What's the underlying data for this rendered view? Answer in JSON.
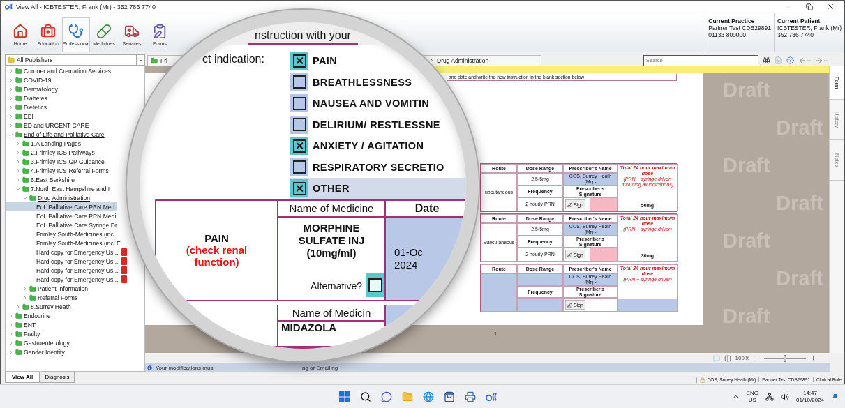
{
  "window": {
    "title": "View All  -  ICBTESTER, Frank (Mr)  -  352 786 7740"
  },
  "toolbar": {
    "buttons": [
      {
        "label": "Home",
        "kind": "home",
        "selected": false
      },
      {
        "label": "Education",
        "kind": "education",
        "selected": false
      },
      {
        "label": "Professional",
        "kind": "professional",
        "selected": true
      },
      {
        "label": "Medicines",
        "kind": "medicines",
        "selected": false
      },
      {
        "label": "Services",
        "kind": "services",
        "selected": false
      },
      {
        "label": "Forms",
        "kind": "forms",
        "selected": false
      }
    ],
    "practice": {
      "heading": "Current Practice",
      "name": "Partner Test CDB29891",
      "phone": "01133 800000"
    },
    "patient": {
      "heading": "Current Patient",
      "name": "ICBTESTER, Frank (Mr)",
      "phone": "352 786 7740"
    }
  },
  "sidebar": {
    "publisher": "All Publishers",
    "tree": [
      {
        "label": "Coroner and Cremation Services",
        "kind": "folder",
        "expanded": false,
        "selected": false
      },
      {
        "label": "COVID-19",
        "kind": "folder",
        "expanded": false,
        "selected": false
      },
      {
        "label": "Dermatology",
        "kind": "folder",
        "expanded": false,
        "selected": false
      },
      {
        "label": "Diabetes",
        "kind": "folder",
        "expanded": false,
        "selected": false
      },
      {
        "label": "Dietetics",
        "kind": "folder",
        "expanded": false,
        "selected": false
      },
      {
        "label": "EBI",
        "kind": "folder",
        "expanded": false,
        "selected": false
      },
      {
        "label": "ED and URGENT CARE",
        "kind": "folder",
        "expanded": false,
        "selected": false
      },
      {
        "label": "End of Life and Palliative Care",
        "kind": "folder",
        "expanded": true,
        "selected": false,
        "children": [
          {
            "label": "1.A Landing Pages",
            "kind": "folder",
            "expanded": false,
            "selected": false
          },
          {
            "label": "2.Frimley ICS Pathways",
            "kind": "folder",
            "expanded": false,
            "selected": false
          },
          {
            "label": "3.Frimley ICS GP Guidance",
            "kind": "folder",
            "expanded": false,
            "selected": false
          },
          {
            "label": "4.Frimley ICS Referral Forms",
            "kind": "folder",
            "expanded": false,
            "selected": false
          },
          {
            "label": "6.East Berkshire",
            "kind": "folder",
            "expanded": false,
            "selected": false
          },
          {
            "label": "7.North East Hampshire and I",
            "kind": "folder",
            "expanded": true,
            "selected": false,
            "children": [
              {
                "label": "Drug Administration",
                "kind": "folder",
                "expanded": true,
                "selected": false,
                "children": [
                  {
                    "label": "EoL Palliative Care PRN Med",
                    "kind": "document",
                    "selected": true
                  },
                  {
                    "label": "EoL Palliative Care PRN Medi",
                    "kind": "document",
                    "selected": false
                  },
                  {
                    "label": "EoL Palliative Care Syringe Dr",
                    "kind": "document",
                    "selected": false
                  },
                  {
                    "label": "Frimley South-Medicines (inc..",
                    "kind": "document",
                    "selected": false
                  },
                  {
                    "label": "Frimley South-Medicines (incl E",
                    "kind": "document",
                    "selected": false
                  },
                  {
                    "label": "Hard copy for Emergency Us...",
                    "kind": "pdf",
                    "selected": false
                  },
                  {
                    "label": "Hard copy for Emergency Us...",
                    "kind": "pdf",
                    "selected": false
                  },
                  {
                    "label": "Hard copy for Emergency Us...",
                    "kind": "pdf",
                    "selected": false
                  },
                  {
                    "label": "Hard copy for Emergency Us...",
                    "kind": "pdf",
                    "selected": false
                  }
                ]
              },
              {
                "label": "Patient Information",
                "kind": "folder",
                "expanded": false,
                "selected": false
              },
              {
                "label": "Referral Forms",
                "kind": "folder",
                "expanded": false,
                "selected": false
              }
            ]
          },
          {
            "label": "8.Surrey Heath",
            "kind": "folder",
            "expanded": false,
            "selected": false
          }
        ]
      },
      {
        "label": "Endocrine",
        "kind": "folder",
        "expanded": false,
        "selected": false
      },
      {
        "label": "ENT",
        "kind": "folder",
        "expanded": false,
        "selected": false
      },
      {
        "label": "Frailty",
        "kind": "folder",
        "expanded": false,
        "selected": false
      },
      {
        "label": "Gastroenterology",
        "kind": "folder",
        "expanded": false,
        "selected": false
      },
      {
        "label": "Gender Identity",
        "kind": "folder",
        "expanded": false,
        "selected": false
      }
    ],
    "tabs": [
      {
        "label": "View All",
        "selected": true
      },
      {
        "label": "Diagnosis",
        "selected": false
      }
    ]
  },
  "navigation": {
    "breadcrumb": [
      "Fri",
      "Drug Administration"
    ],
    "search": {
      "placeholder": "Search"
    }
  },
  "document": {
    "instruction": "and date and write the new instruction in the blank section below",
    "blocks": [
      {
        "route_header": "Route",
        "dose_header": "Dose Range",
        "prescriber_header": "Prescriber's Name",
        "frequency_header": "Frequency",
        "signature_header": "Prescriber's Signature",
        "sign": "Sign",
        "route": "ubcutaneous",
        "dose": "2.5-5mg",
        "prescriber": "COS, Surrey Heath (Mr) -",
        "frequency": "2 hourly PRN",
        "total_title": "Total 24 hour maximum dose",
        "total_note": "(PRN + syringe driver; including all indications)",
        "total": "50mg",
        "signature_missing": true
      },
      {
        "route_header": "Route",
        "dose_header": "Dose Range",
        "prescriber_header": "Prescriber's Name",
        "frequency_header": "Frequency",
        "signature_header": "Prescriber's Signature",
        "sign": "Sign",
        "route": "Subcutaneous",
        "dose": "2.5-5mg",
        "prescriber": "COS, Surrey Heath (Mr) -",
        "frequency": "2 hourly PRN",
        "total_title": "Total 24 hour maximum dose",
        "total_note": "(PRN + syringe driver)",
        "total": "30mg",
        "signature_missing": true
      },
      {
        "route_header": "Route",
        "dose_header": "Dose Range",
        "prescriber_header": "Prescriber's Name",
        "frequency_header": "Frequency",
        "signature_header": "Prescriber's Signature",
        "sign": "Sign",
        "prescriber": "COS, Surrey Heath (Mr) -",
        "total_title": "Total 24 hour maximum dose",
        "total_note": "(PRN + syringe driver)",
        "signature_missing": false
      }
    ],
    "page_number": "1",
    "draft_marks": [
      "Draft",
      "Draft",
      "Draft",
      "Draft",
      "Draft",
      "Draft",
      "Draft"
    ]
  },
  "side_tabs": [
    {
      "label": "Form",
      "selected": true
    },
    {
      "label": "History",
      "selected": false
    },
    {
      "label": "Notes",
      "selected": false
    }
  ],
  "zoom": {
    "reading": "100%",
    "level": 0.5
  },
  "info_bar": [
    "Your modifications mus",
    "ng or Emailing"
  ],
  "status_bar": [
    "COS, Surrey Heath (Mr)",
    "Partner Test CDB29891",
    "Clinical Role"
  ],
  "lens": {
    "heading": "nstruction with your",
    "indication_label": "ct indication:",
    "indications": [
      {
        "label": "PAIN",
        "checked": true,
        "highlighted": false
      },
      {
        "label": "BREATHLESSNESS",
        "checked": false,
        "highlighted": false
      },
      {
        "label": "NAUSEA AND VOMITIN",
        "checked": false,
        "highlighted": false
      },
      {
        "label": "DELIRIUM/ RESTLESSNE",
        "checked": false,
        "highlighted": false
      },
      {
        "label": "ANXIETY / AGITATION",
        "checked": true,
        "highlighted": false
      },
      {
        "label": "RESPIRATORY SECRETIO",
        "checked": false,
        "highlighted": false
      },
      {
        "label": "OTHER",
        "checked": true,
        "highlighted": true
      }
    ],
    "medicines": [
      {
        "condition": "PAIN",
        "note": "(check renal function)",
        "name_header": "Name of Medicine",
        "name": "MORPHINE SULFATE INJ (10mg/ml)",
        "date_header": "Date",
        "date": "01-Oc 2024",
        "alternative_label": "Alternative?",
        "alternative_checked": false
      },
      {
        "name_header": "Name of Medicin",
        "name": "MIDAZOLA"
      }
    ]
  },
  "taskbar": {
    "language": "ENG",
    "region": "US",
    "time": "14:47",
    "date": "01/10/2024"
  }
}
